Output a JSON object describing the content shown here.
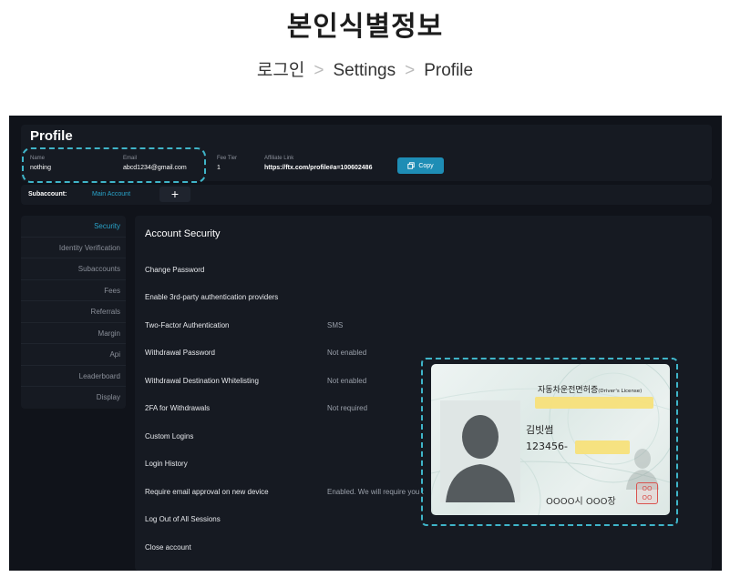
{
  "page": {
    "title": "본인식별정보",
    "breadcrumb": [
      "로그인",
      "Settings",
      "Profile"
    ],
    "breadcrumb_separator": ">"
  },
  "profile": {
    "title": "Profile",
    "name_label": "Name",
    "name_value": "nothing",
    "email_label": "Email",
    "email_value": "abcd1234@gmail.com",
    "fee_tier_label": "Fee Tier",
    "fee_tier_value": "1",
    "affiliate_label": "Affiliate Link",
    "affiliate_value": "https://ftx.com/profile#a=100602486",
    "copy_label": "Copy"
  },
  "subaccount": {
    "label": "Subaccount:",
    "current": "Main Account",
    "add_label": "+"
  },
  "sidebar": {
    "items": [
      {
        "label": "Security",
        "active": true
      },
      {
        "label": "Identity Verification",
        "active": false
      },
      {
        "label": "Subaccounts",
        "active": false
      },
      {
        "label": "Fees",
        "active": false
      },
      {
        "label": "Referrals",
        "active": false
      },
      {
        "label": "Margin",
        "active": false
      },
      {
        "label": "Api",
        "active": false
      },
      {
        "label": "Leaderboard",
        "active": false
      },
      {
        "label": "Display",
        "active": false
      }
    ]
  },
  "security": {
    "title": "Account Security",
    "rows": [
      {
        "label": "Change Password",
        "value": ""
      },
      {
        "label": "Enable 3rd-party authentication providers",
        "value": ""
      },
      {
        "label": "Two-Factor Authentication",
        "value": "SMS"
      },
      {
        "label": "Withdrawal Password",
        "value": "Not enabled"
      },
      {
        "label": "Withdrawal Destination Whitelisting",
        "value": "Not enabled"
      },
      {
        "label": "2FA for Withdrawals",
        "value": "Not required"
      },
      {
        "label": "Custom Logins",
        "value": ""
      },
      {
        "label": "Login History",
        "value": ""
      },
      {
        "label": "Require email approval on new device",
        "value": "Enabled. We will require you t"
      },
      {
        "label": "Log Out of All Sessions",
        "value": ""
      },
      {
        "label": "Close account",
        "value": ""
      }
    ]
  },
  "license": {
    "title": "자동차운전면허증",
    "title_en": "(Driver's License)",
    "name": "김빗썸",
    "number": "123456-",
    "issuer": "OOOO시 OOO장",
    "stamp": "OO OO"
  },
  "colors": {
    "accent": "#29a3c9",
    "highlight": "#3fb5c9",
    "panel": "#161a22",
    "background": "#10131a",
    "mask": "#f7e07a"
  },
  "icons": {
    "copy": "copy-icon",
    "add": "plus-icon",
    "separator": "chevron-right-icon"
  }
}
